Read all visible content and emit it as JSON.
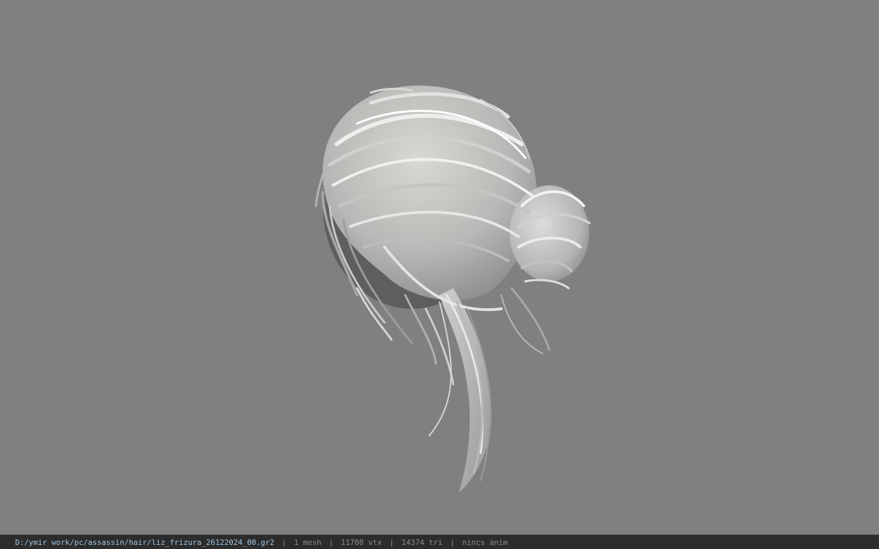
{
  "viewport": {
    "background": "#808080",
    "model": "hair-mesh"
  },
  "status": {
    "file_path": "D:/ymir work/pc/assassin/hair/liz_frizura_26122024_00.gr2",
    "separator": "|",
    "mesh_count": "1 mesh",
    "vertex_count": "11708 vtx",
    "triangle_count": "14374 tri",
    "anim_state": "nincs anim",
    "path_color": "#9fc7e6",
    "bar_color": "#2c2c2c"
  }
}
